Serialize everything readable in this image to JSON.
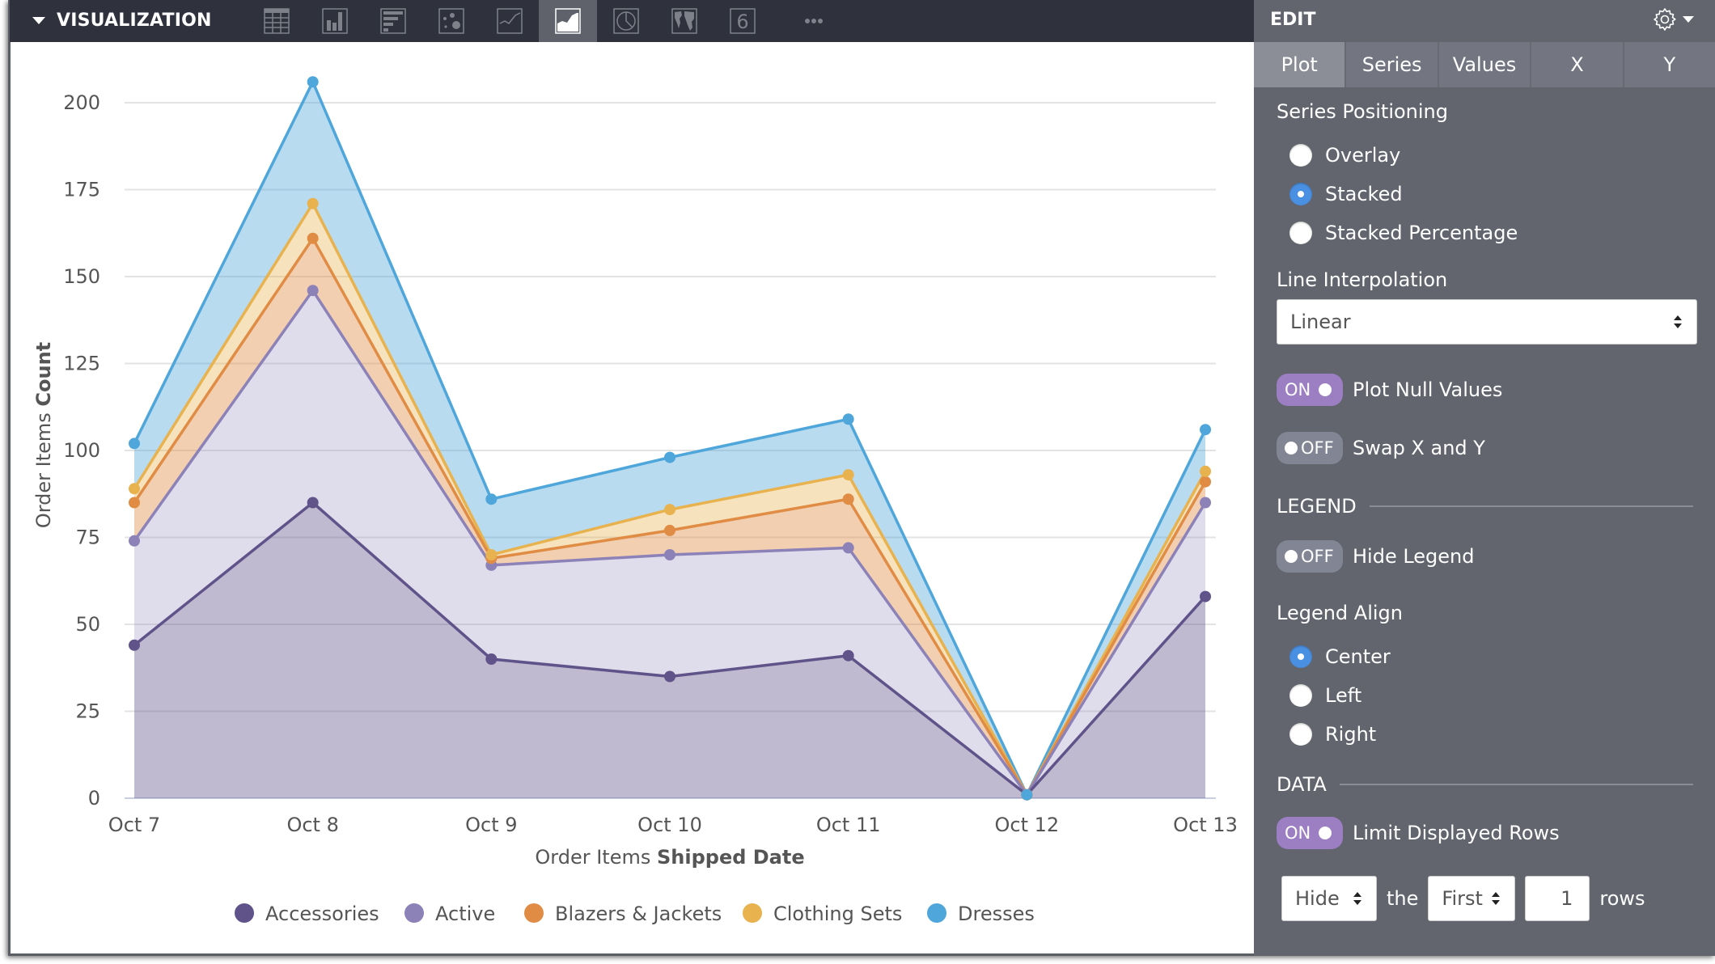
{
  "visualization": {
    "title": "VISUALIZATION",
    "icons": [
      {
        "name": "table-icon",
        "active": false
      },
      {
        "name": "column-chart-icon",
        "active": false
      },
      {
        "name": "bar-chart-icon",
        "active": false
      },
      {
        "name": "scatter-chart-icon",
        "active": false
      },
      {
        "name": "line-chart-icon",
        "active": false
      },
      {
        "name": "area-chart-icon",
        "active": true
      },
      {
        "name": "pie-chart-icon",
        "active": false
      },
      {
        "name": "map-icon",
        "active": false
      },
      {
        "name": "single-value-icon",
        "active": false
      },
      {
        "name": "more-icon",
        "active": false
      }
    ],
    "single_value_glyph": "6",
    "more_glyph": "•••"
  },
  "edit": {
    "title": "EDIT",
    "tabs": [
      {
        "label": "Plot",
        "active": true
      },
      {
        "label": "Series",
        "active": false
      },
      {
        "label": "Values",
        "active": false
      },
      {
        "label": "X",
        "active": false
      },
      {
        "label": "Y",
        "active": false
      }
    ],
    "series_positioning": {
      "label": "Series Positioning",
      "options": [
        "Overlay",
        "Stacked",
        "Stacked Percentage"
      ],
      "selected": "Stacked"
    },
    "line_interpolation": {
      "label": "Line Interpolation",
      "value": "Linear"
    },
    "plot_null_values": {
      "label": "Plot Null Values",
      "state": "ON"
    },
    "swap_xy": {
      "label": "Swap X and Y",
      "state": "OFF"
    },
    "legend_section": "LEGEND",
    "hide_legend": {
      "label": "Hide Legend",
      "state": "OFF"
    },
    "legend_align": {
      "label": "Legend Align",
      "options": [
        "Center",
        "Left",
        "Right"
      ],
      "selected": "Center"
    },
    "data_section": "DATA",
    "limit_rows": {
      "label": "Limit Displayed Rows",
      "state": "ON"
    },
    "limit_config": {
      "action": "Hide",
      "the_label": "the",
      "position": "First",
      "count": "1",
      "rows_label": "rows"
    }
  },
  "colors": {
    "accessories": "#5f5389",
    "active": "#8c82b8",
    "blazers": "#e08c45",
    "clothing": "#e8b24f",
    "dresses": "#4ea6da",
    "header_bg": "#2f323d",
    "panel_bg": "#62656e",
    "toggle_on": "#9b7fc2",
    "radio_selected": "#4a90e2"
  },
  "chart_data": {
    "type": "area",
    "stacked": true,
    "title": "",
    "xlabel_prefix": "Order Items ",
    "xlabel_bold": "Shipped Date",
    "ylabel_prefix": "Order Items ",
    "ylabel_bold": "Count",
    "categories": [
      "Oct 7",
      "Oct 8",
      "Oct 9",
      "Oct 10",
      "Oct 11",
      "Oct 12",
      "Oct 13"
    ],
    "ylim": [
      0,
      212
    ],
    "yticks": [
      0,
      25,
      50,
      75,
      100,
      125,
      150,
      175,
      200
    ],
    "grid": true,
    "legend_position": "bottom-center",
    "series": [
      {
        "name": "Accessories",
        "key": "accessories",
        "values": [
          44,
          85,
          40,
          35,
          41,
          1,
          58
        ]
      },
      {
        "name": "Active",
        "key": "active",
        "values": [
          30,
          61,
          27,
          35,
          31,
          0,
          27
        ]
      },
      {
        "name": "Blazers & Jackets",
        "key": "blazers",
        "values": [
          11,
          15,
          2,
          7,
          14,
          0,
          6
        ]
      },
      {
        "name": "Clothing Sets",
        "key": "clothing",
        "values": [
          4,
          10,
          1,
          6,
          7,
          0,
          3
        ]
      },
      {
        "name": "Dresses",
        "key": "dresses",
        "values": [
          13,
          35,
          16,
          15,
          16,
          0,
          12
        ]
      }
    ]
  }
}
